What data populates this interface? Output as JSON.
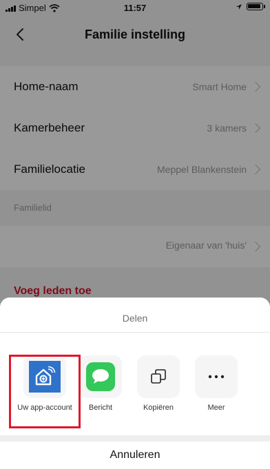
{
  "status_bar": {
    "carrier": "Simpel",
    "time": "11:57"
  },
  "nav": {
    "title": "Familie instelling",
    "back_icon": "chevron-left-icon"
  },
  "settings": {
    "rows": [
      {
        "label": "Home-naam",
        "value": "Smart Home"
      },
      {
        "label": "Kamerbeheer",
        "value": "3 kamers"
      },
      {
        "label": "Familielocatie",
        "value": "Meppel Blankenstein"
      }
    ],
    "section_header": "Familielid",
    "owner_value": "Eigenaar van 'huis'",
    "add_members": "Voeg leden toe"
  },
  "share_sheet": {
    "title": "Delen",
    "items": [
      {
        "label": "Uw app-account",
        "icon": "app-account-icon"
      },
      {
        "label": "Bericht",
        "icon": "message-icon"
      },
      {
        "label": "Kopiëren",
        "icon": "copy-icon"
      },
      {
        "label": "Meer",
        "icon": "more-icon"
      }
    ],
    "cancel": "Annuleren"
  },
  "colors": {
    "accent_red": "#d0152c",
    "highlight_red": "#e3142a",
    "message_green": "#34c759",
    "app_blue": "#2f72c9"
  }
}
